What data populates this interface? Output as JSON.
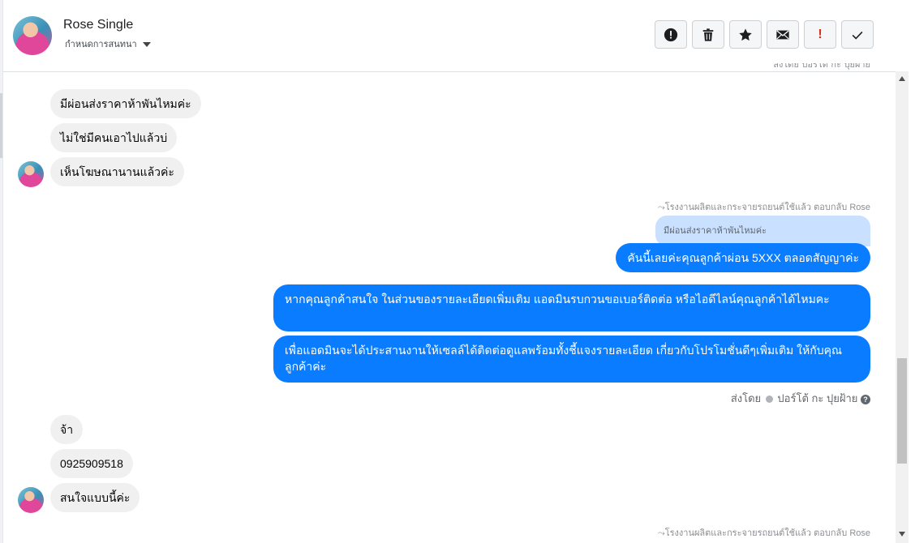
{
  "header": {
    "contact_name": "Rose Single",
    "assign_label": "กำหนดการสนทนา",
    "toolbar": [
      {
        "icon": "alert-circle-icon",
        "label": ""
      },
      {
        "icon": "trash-icon",
        "label": ""
      },
      {
        "icon": "star-icon",
        "label": ""
      },
      {
        "icon": "envelope-icon",
        "label": ""
      },
      {
        "icon": "exclamation-icon",
        "label": "!"
      },
      {
        "icon": "check-icon",
        "label": ""
      }
    ]
  },
  "clipped_top_text": "ส่งโดย ปอร์โต้ กะ ปุยฝ้าย",
  "incoming_group_1": [
    "มีผ่อนส่งราคาห้าพันไหมค่ะ",
    "ไม่ใช่มีคนเอาไปแล้วบ่",
    "เห็นโฆษณานานแล้วค่ะ"
  ],
  "reply_meta_1": "โรงงานผลิตและกระจายรถยนต์ใช้แล้ว ตอบกลับ Rose",
  "quoted_text": "มีผ่อนส่งราคาห้าพันไหมค่ะ",
  "outgoing": [
    "คันนี้เลยค่ะคุณลูกค้าผ่อน 5XXX ตลอดสัญญาค่ะ",
    "หากคุณลูกค้าสนใจ ในส่วนของรายละเอียดเพิ่มเติม แอดมินรบกวนขอเบอร์ติดต่อ หรือไอดีไลน์คุณลูกค้าได้ไหมคะ",
    "เพื่อแอดมินจะได้ประสานงานให้เซลล์ได้ติดต่อดูแลพร้อมทั้งชี้แจงรายละเอียด เกี่ยวกับโปรโมชั่นดีๆเพิ่มเติม ให้กับคุณลูกค้าค่ะ"
  ],
  "sent_by": {
    "prefix": "ส่งโดย",
    "names": "ปอร์โต้ กะ ปุยฝ้าย"
  },
  "incoming_group_2": [
    "จ้า",
    "0925909518",
    "สนใจแบบนี้ค่ะ"
  ],
  "reply_meta_2": "โรงงานผลิตและกระจายรถยนต์ใช้แล้ว ตอบกลับ Rose",
  "colors": {
    "accent": "#0a7cff",
    "incoming_bubble": "#f0f0f0",
    "quote_bg": "#c9e0ff"
  }
}
